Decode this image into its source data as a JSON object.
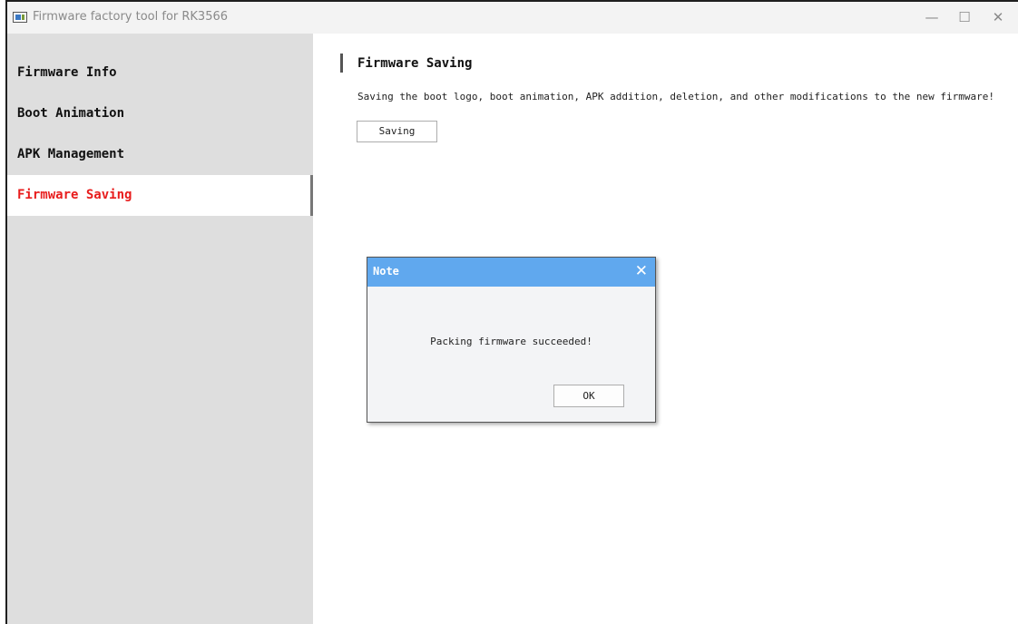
{
  "window": {
    "title": "Firmware factory tool for RK3566",
    "controls": {
      "minimize": "—",
      "maximize": "☐",
      "close": "✕"
    }
  },
  "sidebar": {
    "items": [
      {
        "label": "Firmware Info",
        "active": false
      },
      {
        "label": "Boot Animation",
        "active": false
      },
      {
        "label": "APK Management",
        "active": false
      },
      {
        "label": "Firmware Saving",
        "active": true
      }
    ]
  },
  "main": {
    "section_title": "Firmware Saving",
    "description": "Saving the boot logo, boot animation, APK addition, deletion, and other modifications to the new firmware!",
    "save_button": "Saving"
  },
  "dialog": {
    "title": "Note",
    "close_glyph": "✕",
    "message": "Packing firmware succeeded!",
    "ok_button": "OK"
  },
  "colors": {
    "active_nav_text": "#e81d1d",
    "sidebar_bg": "#dedede",
    "dialog_header": "#60a8ee"
  }
}
